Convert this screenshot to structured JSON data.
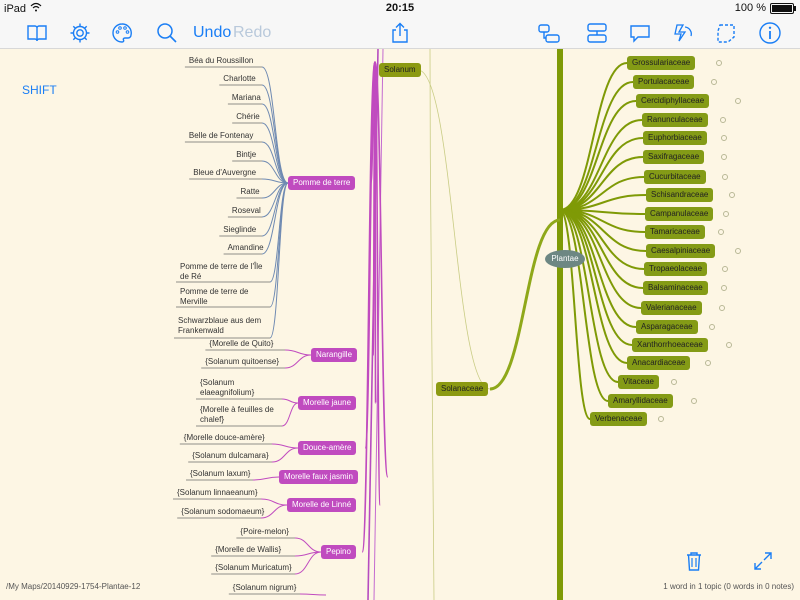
{
  "status_bar": {
    "device": "iPad",
    "time": "20:15",
    "battery": "100 %"
  },
  "toolbar": {
    "undo_label": "Undo",
    "redo_label": "Redo"
  },
  "shift_label": "SHIFT",
  "plantae_label": "Plantae",
  "solanum_label": "Solanum",
  "solanaceae_label": "Solanaceae",
  "potato_varieties": [
    "Béa du Roussillon",
    "Charlotte",
    "Mariana",
    "Chérie",
    "Belle de Fontenay",
    "Bintje",
    "Bleue d'Auvergne",
    "Ratte",
    "Roseval",
    "Sieglinde",
    "Amandine",
    "Pomme de terre de l'Île de Ré",
    "Pomme de terre de Merville",
    "Schwarzblaue aus dem Frankenwald"
  ],
  "species": [
    {
      "label": "Pomme de terre"
    },
    {
      "label": "Narangille",
      "synonyms": [
        "{Morelle de Quito}",
        "{Solanum quitoense}"
      ]
    },
    {
      "label": "Morelle jaune",
      "synonyms": [
        "{Solanum elaeagnifolium}",
        "{Morelle à feuilles de chalef}"
      ]
    },
    {
      "label": "Douce-amère",
      "synonyms": [
        "{Morelle douce-amère}",
        "{Solanum dulcamara}"
      ]
    },
    {
      "label": "Morelle faux jasmin",
      "synonyms": [
        "{Solanum laxum}"
      ]
    },
    {
      "label": "Morelle de Linné",
      "synonyms": [
        "{Solanum linnaeanum}",
        "{Solanum sodomaeum}"
      ]
    },
    {
      "label": "Pepino",
      "synonyms": [
        "{Poire-melon}",
        "{Morelle de Wallis}",
        "{Solanum Muricatum}"
      ]
    },
    {
      "label": "",
      "synonyms": [
        "{Solanum nigrum}"
      ]
    }
  ],
  "families": [
    "Grossulariaceae",
    "Portulacaceae",
    "Cercidiphyllaceae",
    "Ranunculaceae",
    "Euphorbiaceae",
    "Saxifragaceae",
    "Cucurbitaceae",
    "Schisandraceae",
    "Campanulaceae",
    "Tamaricaceae",
    "Caesalpiniaceae",
    "Tropaeolaceae",
    "Balsaminaceae",
    "Valerianaceae",
    "Asparagaceae",
    "Xanthorrhoeaceae",
    "Anacardiaceae",
    "Vitaceae",
    "Amaryllidaceae",
    "Verbenaceae"
  ],
  "footer": {
    "path": "/My Maps/20140929-1754-Plantae-12",
    "counter": "1 word in 1 topic (0 words in 0 notes)"
  },
  "colors": {
    "accent": "#1a7ef5",
    "purple": "#c04bbf",
    "green": "#8c9a12",
    "plantae": "#6d8783"
  }
}
